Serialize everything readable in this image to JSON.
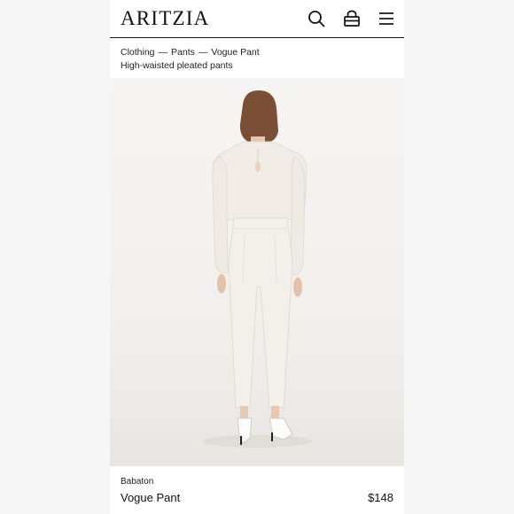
{
  "header": {
    "logo": "ARITZIA",
    "icons": [
      "search-icon",
      "bag-icon",
      "menu-icon"
    ]
  },
  "breadcrumb": {
    "items": [
      "Clothing",
      "Pants",
      "Vogue Pant"
    ],
    "separator": "—",
    "subtitle": "High-waisted pleated pants"
  },
  "product": {
    "brand": "Babaton",
    "name": "Vogue Pant",
    "price": "$148"
  },
  "colors": {
    "garment": "#efebe3",
    "text": "#1a1a1a",
    "background": "#ffffff"
  }
}
